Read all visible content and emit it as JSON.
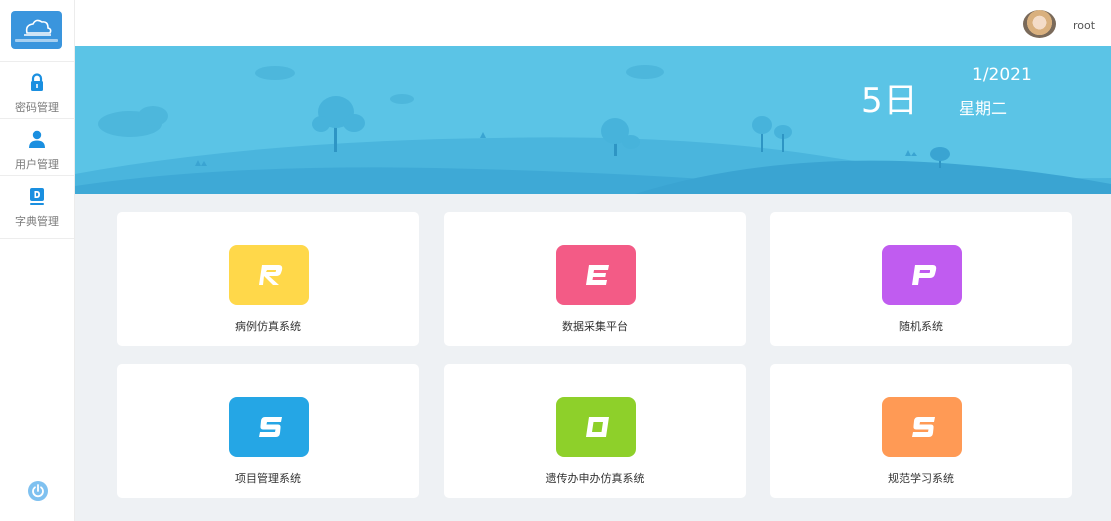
{
  "sidebar": {
    "logo": {
      "icon": "cloud-logo-icon",
      "color": "#3a95dd"
    },
    "items": [
      {
        "label": "密码管理",
        "icon": "lock-icon"
      },
      {
        "label": "用户管理",
        "icon": "user-icon"
      },
      {
        "label": "字典管理",
        "icon": "dictionary-icon"
      }
    ],
    "power": {
      "icon": "power-icon"
    }
  },
  "header": {
    "username": "root",
    "avatar": "user-avatar"
  },
  "banner": {
    "day": "5日",
    "month": "1/2021",
    "weekday": "星期二",
    "colors": {
      "sky": "#5bc4e6",
      "hills": "#3ea9d6"
    }
  },
  "apps": [
    {
      "label": "病例仿真系统",
      "icon": "letter-r-icon",
      "color": "#ffd84a"
    },
    {
      "label": "数据采集平台",
      "icon": "letter-e-icon",
      "color": "#f35b86"
    },
    {
      "label": "随机系统",
      "icon": "letter-p-icon",
      "color": "#c05cf0"
    },
    {
      "label": "项目管理系统",
      "icon": "letter-s-icon",
      "color": "#25a6e5"
    },
    {
      "label": "遗传办申办仿真系统",
      "icon": "letter-o-icon",
      "color": "#8ed02a"
    },
    {
      "label": "规范学习系统",
      "icon": "letter-s-icon",
      "color": "#ff9a55"
    }
  ]
}
